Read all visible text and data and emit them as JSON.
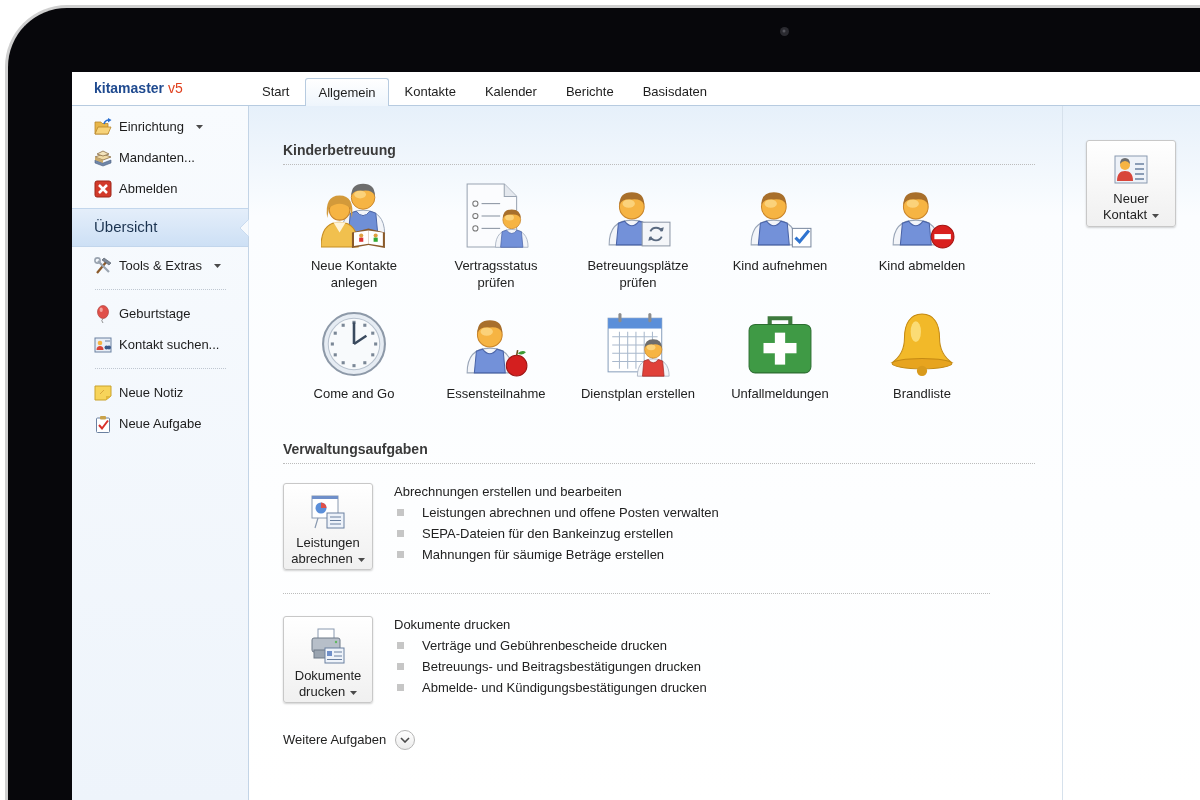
{
  "app": {
    "logo": {
      "name": "kitamaster",
      "version": "v5"
    }
  },
  "tabs": [
    {
      "label": "Start",
      "selected": false
    },
    {
      "label": "Allgemein",
      "selected": true
    },
    {
      "label": "Kontakte",
      "selected": false
    },
    {
      "label": "Kalender",
      "selected": false
    },
    {
      "label": "Berichte",
      "selected": false
    },
    {
      "label": "Basisdaten",
      "selected": false
    }
  ],
  "sidebar": {
    "commands": [
      {
        "label": "Einrichtung",
        "has_menu": true
      },
      {
        "label": "Mandanten...",
        "has_menu": false
      },
      {
        "label": "Abmelden",
        "has_menu": false
      }
    ],
    "views": [
      {
        "label": "Übersicht",
        "selected": true
      }
    ],
    "groups": [
      [
        {
          "label": "Tools & Extras",
          "has_menu": true
        }
      ],
      [
        {
          "label": "Geburtstage",
          "has_menu": false
        },
        {
          "label": "Kontakt suchen...",
          "has_menu": false
        }
      ],
      [
        {
          "label": "Neue Notiz",
          "has_menu": false
        },
        {
          "label": "Neue Aufgabe",
          "has_menu": false
        }
      ]
    ]
  },
  "tile_section": {
    "title": "Kinderbetreuung",
    "tiles": [
      {
        "label": "Neue Kontakte\nanlegen"
      },
      {
        "label": "Vertragsstatus\nprüfen"
      },
      {
        "label": "Betreuungsplätze\nprüfen"
      },
      {
        "label": "Kind aufnehmen"
      },
      {
        "label": "Kind abmelden"
      },
      {
        "label": "Come and Go"
      },
      {
        "label": "Essensteilnahme"
      },
      {
        "label": "Dienstplan erstellen"
      },
      {
        "label": "Unfallmeldungen"
      },
      {
        "label": "Brandliste"
      }
    ]
  },
  "task_section": {
    "title": "Verwaltungsaufgaben",
    "tasks": [
      {
        "button": {
          "label": "Leistungen\nabrechnen",
          "has_menu": true
        },
        "title": "Abrechnungen erstellen und bearbeiten",
        "items": [
          "Leistungen abrechnen und offene Posten verwalten",
          "SEPA-Dateien für den Bankeinzug erstellen",
          "Mahnungen für säumige Beträge erstellen"
        ]
      },
      {
        "button": {
          "label": "Dokumente\ndrucken",
          "has_menu": true
        },
        "title": "Dokumente drucken",
        "items": [
          "Verträge und Gebührenbescheide drucken",
          "Betreuungs- und Beitragsbestätigungen drucken",
          "Abmelde- und Kündigungsbestätigungen drucken"
        ]
      }
    ],
    "more": {
      "label": "Weitere Aufgaben",
      "expanded": false
    }
  },
  "right_panel": {
    "buttons": [
      {
        "label": "Neuer\nKontakt",
        "has_menu": true
      }
    ]
  }
}
